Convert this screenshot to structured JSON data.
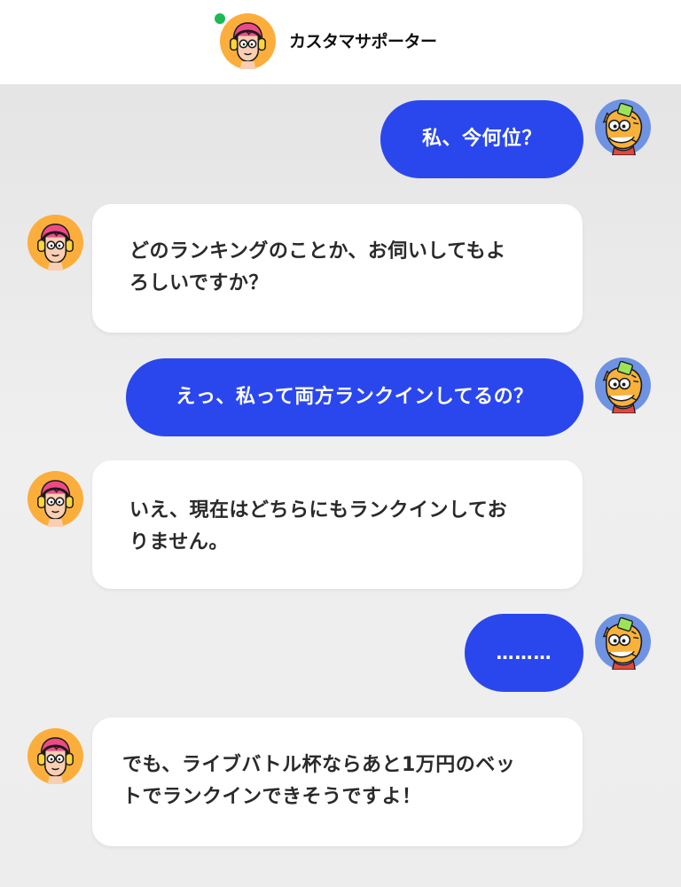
{
  "colors": {
    "accent": "#2a47ee",
    "online": "#1db954",
    "support_bubble": "#ffffff",
    "header_bg": "#ffffff"
  },
  "header": {
    "title": "カスタマサポーター",
    "avatar_icon": "support-agent-avatar-icon",
    "status_icon": "online-status-dot"
  },
  "messages": [
    {
      "sender": "user",
      "avatar_icon": "tiger-mascot-avatar-icon",
      "text": "私、今何位？"
    },
    {
      "sender": "support",
      "avatar_icon": "support-agent-avatar-icon",
      "lines": [
        "どのランキングのことか、お伺いしてもよ",
        "ろしいですか？"
      ]
    },
    {
      "sender": "user",
      "avatar_icon": "tiger-mascot-avatar-icon",
      "text": "えっ、私って両方ランクインしてるの？"
    },
    {
      "sender": "support",
      "avatar_icon": "support-agent-avatar-icon",
      "lines": [
        "いえ、現在はどちらにもランクインしてお",
        "りません。"
      ]
    },
    {
      "sender": "user",
      "avatar_icon": "tiger-mascot-avatar-icon",
      "text": "………"
    },
    {
      "sender": "support",
      "avatar_icon": "support-agent-avatar-icon",
      "lines": [
        "でも、ライブバトル杯ならあと1万円のベッ",
        "トでランクインできそうですよ！"
      ]
    }
  ]
}
